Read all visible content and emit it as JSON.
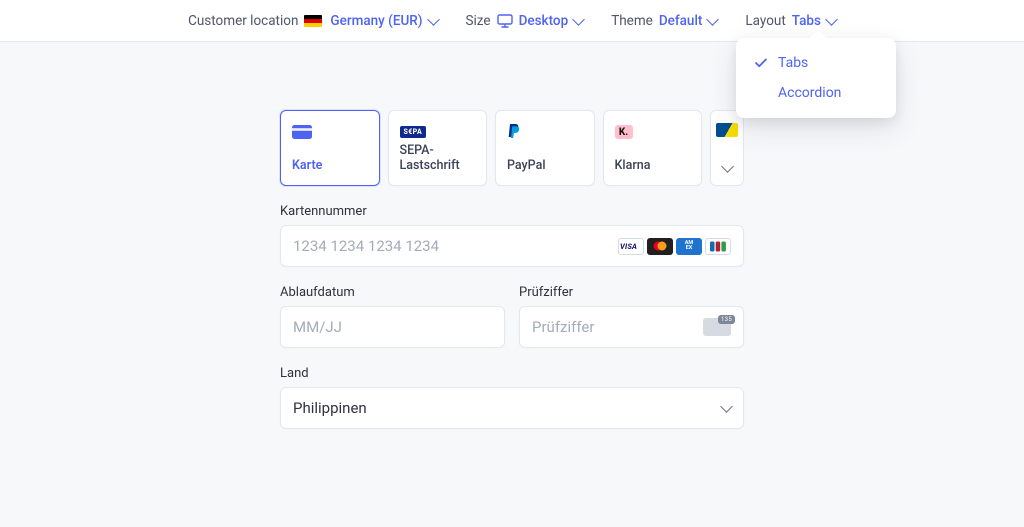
{
  "topbar": {
    "location_label": "Customer location",
    "location_value": "Germany (EUR)",
    "size_label": "Size",
    "size_value": "Desktop",
    "theme_label": "Theme",
    "theme_value": "Default",
    "layout_label": "Layout",
    "layout_value": "Tabs"
  },
  "layout_dropdown": {
    "options": [
      {
        "label": "Tabs",
        "selected": true
      },
      {
        "label": "Accordion",
        "selected": false
      }
    ]
  },
  "payment_tabs": [
    {
      "key": "card",
      "label": "Karte",
      "active": true
    },
    {
      "key": "sepa",
      "label": "SEPA-Lastschrift",
      "active": false
    },
    {
      "key": "paypal",
      "label": "PayPal",
      "active": false
    },
    {
      "key": "klarna",
      "label": "Klarna",
      "active": false
    }
  ],
  "form": {
    "card_number_label": "Kartennummer",
    "card_number_placeholder": "1234 1234 1234 1234",
    "expiry_label": "Ablaufdatum",
    "expiry_placeholder": "MM/JJ",
    "cvc_label": "Prüfziffer",
    "cvc_placeholder": "Prüfziffer",
    "country_label": "Land",
    "country_value": "Philippinen"
  },
  "card_brands": {
    "visa": "VISA",
    "amex": "AM\nEX",
    "jcb": "JCB"
  },
  "icons": {
    "sepa_text": "S€PA",
    "klarna_text": "K."
  }
}
